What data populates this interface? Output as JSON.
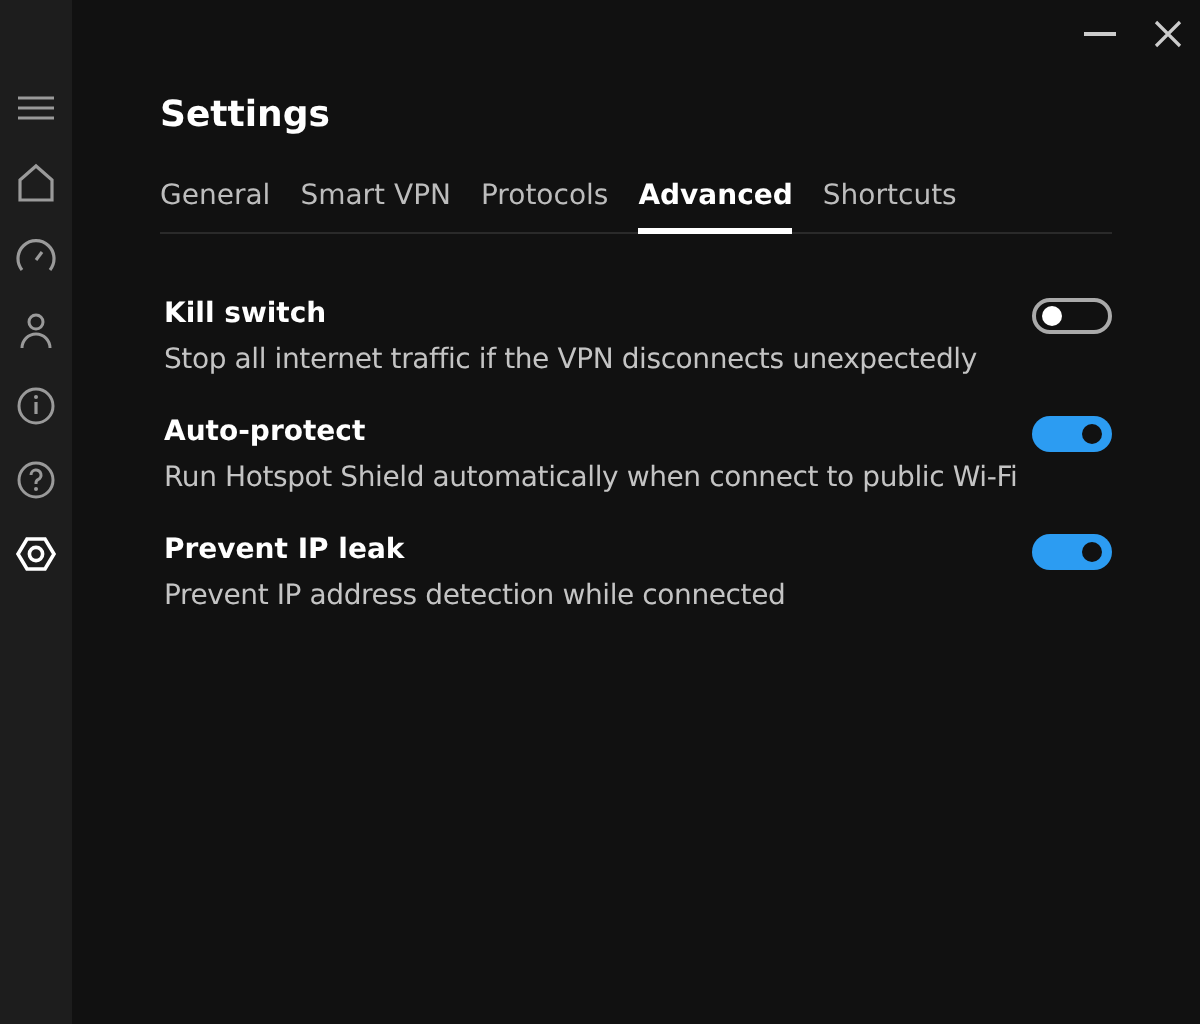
{
  "sidebar": {
    "items": [
      {
        "kind": "menu",
        "selected": false
      },
      {
        "kind": "home",
        "selected": false
      },
      {
        "kind": "speed",
        "selected": false
      },
      {
        "kind": "account",
        "selected": false
      },
      {
        "kind": "info",
        "selected": false
      },
      {
        "kind": "help",
        "selected": false
      },
      {
        "kind": "settings",
        "selected": true
      }
    ]
  },
  "title": "Settings",
  "tabs": [
    {
      "label": "General",
      "selected": false
    },
    {
      "label": "Smart VPN",
      "selected": false
    },
    {
      "label": "Protocols",
      "selected": false
    },
    {
      "label": "Advanced",
      "selected": true
    },
    {
      "label": "Shortcuts",
      "selected": false
    }
  ],
  "settings": [
    {
      "title": "Kill switch",
      "description": "Stop all internet traffic if the VPN disconnects unexpectedly",
      "on": false
    },
    {
      "title": "Auto-protect",
      "description": "Run Hotspot Shield automatically when connect to public Wi-Fi",
      "on": true
    },
    {
      "title": "Prevent IP leak",
      "description": "Prevent IP address detection while connected",
      "on": true
    }
  ]
}
